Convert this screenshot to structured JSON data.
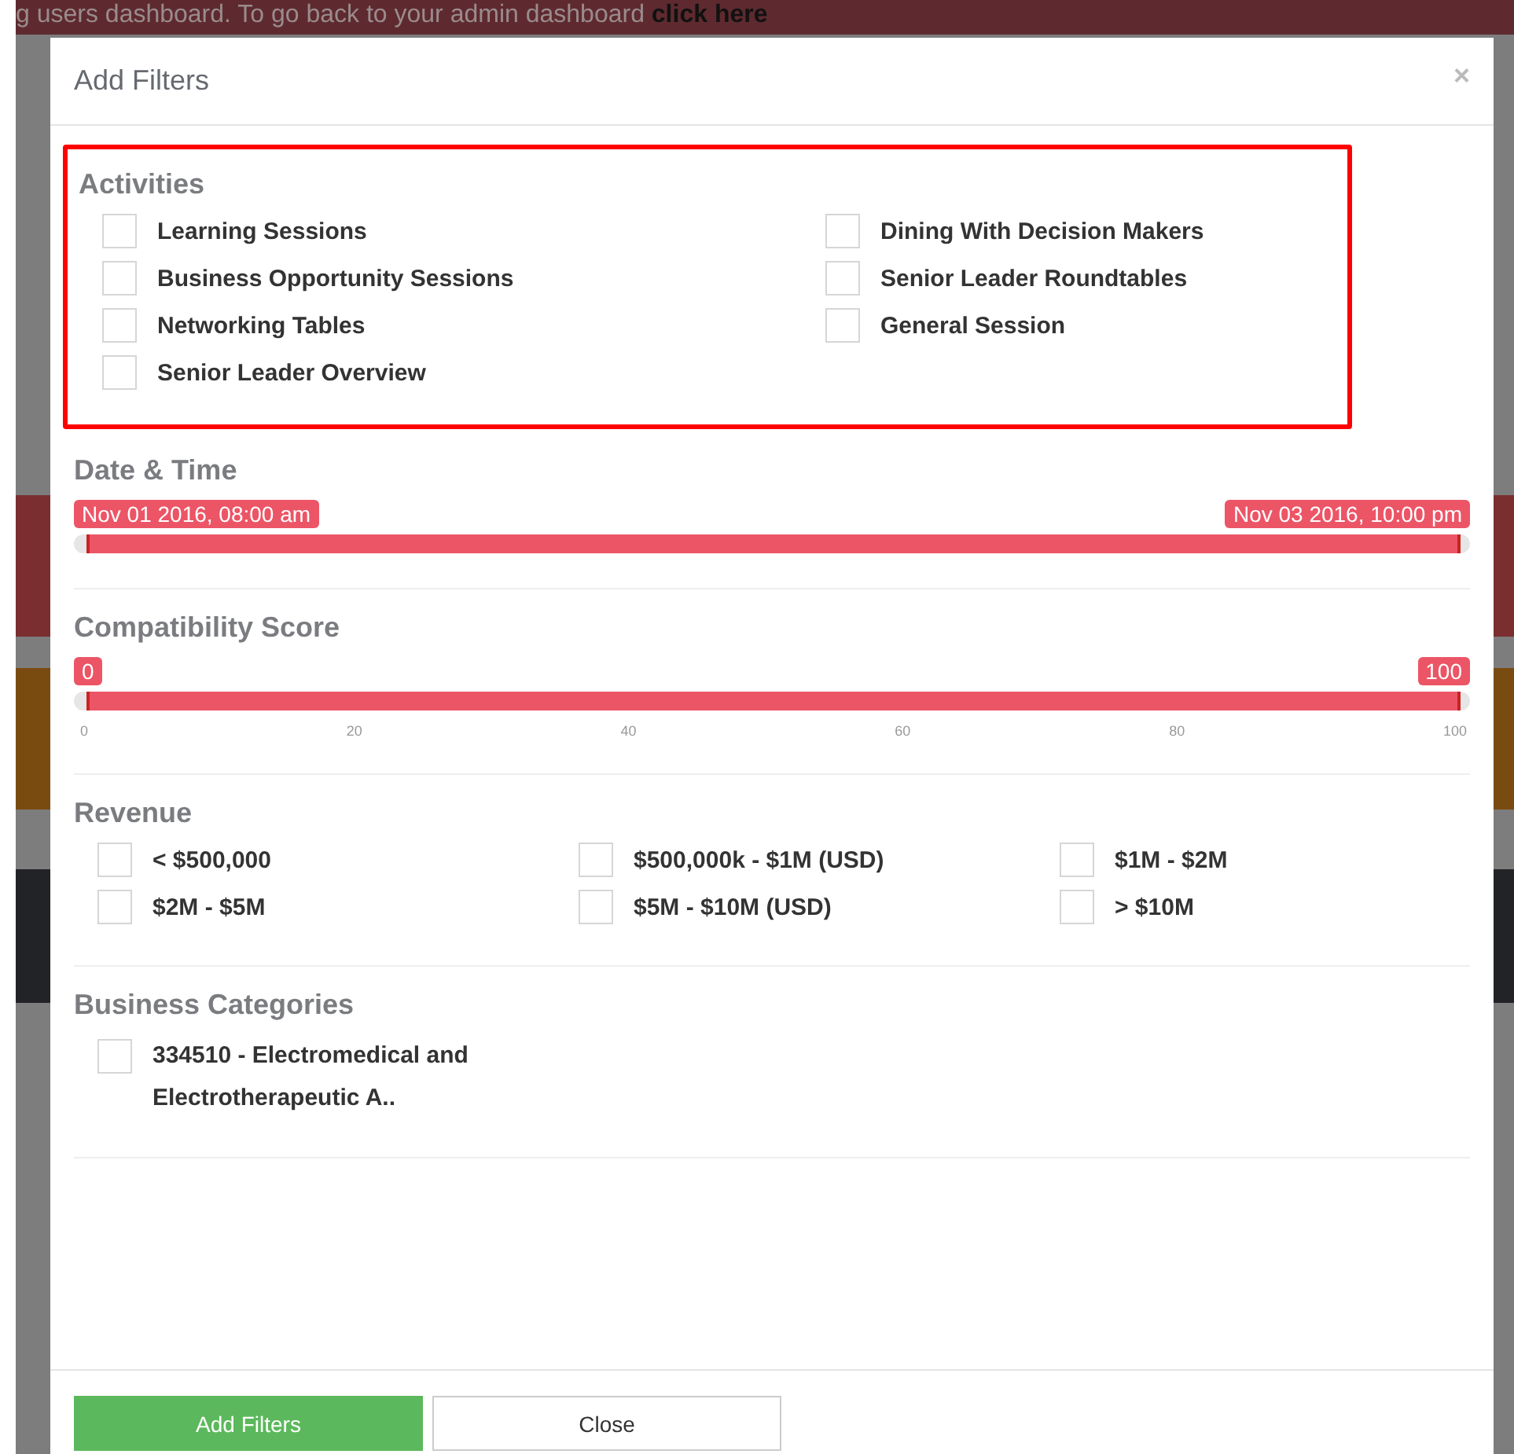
{
  "banner": {
    "text": "g users dashboard. To go back to your admin dashboard ",
    "link": "click here"
  },
  "modal": {
    "title": "Add Filters",
    "close": "×"
  },
  "activities": {
    "title": "Activities",
    "highlighted": true,
    "items": [
      {
        "label": "Learning Sessions",
        "checked": false
      },
      {
        "label": "Dining With Decision Makers",
        "checked": false
      },
      {
        "label": "Business Opportunity Sessions",
        "checked": false
      },
      {
        "label": "Senior Leader Roundtables",
        "checked": false
      },
      {
        "label": "Networking Tables",
        "checked": false
      },
      {
        "label": "General Session",
        "checked": false
      },
      {
        "label": "Senior Leader Overview",
        "checked": false
      }
    ]
  },
  "date_time": {
    "title": "Date & Time",
    "from": "Nov 01 2016, 08:00 am",
    "to": "Nov 03 2016, 10:00 pm",
    "level": 1
  },
  "compatibility": {
    "title": "Compatibility Score",
    "from": "0",
    "to": "100",
    "level": 1,
    "ticks": [
      "0",
      "20",
      "40",
      "60",
      "80",
      "100"
    ]
  },
  "revenue": {
    "title": "Revenue",
    "items": [
      {
        "label": "< $500,000",
        "checked": false
      },
      {
        "label": "$500,000k - $1M (USD)",
        "checked": false
      },
      {
        "label": "$1M - $2M",
        "checked": false
      },
      {
        "label": "$2M - $5M",
        "checked": false
      },
      {
        "label": "$5M - $10M (USD)",
        "checked": false
      },
      {
        "label": "> $10M",
        "checked": false
      }
    ]
  },
  "categories": {
    "title": "Business Categories",
    "items": [
      {
        "label": "334510 - Electromedical and Electrotherapeutic A..",
        "checked": false
      }
    ]
  },
  "buttons": [
    {
      "label": "Add Filters",
      "kind": "primary"
    },
    {
      "label": "Close",
      "kind": "secondary"
    }
  ]
}
